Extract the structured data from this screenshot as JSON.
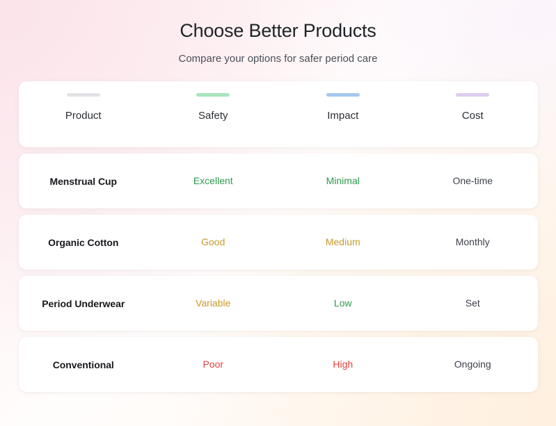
{
  "header": {
    "title": "Choose Better Products",
    "subtitle": "Compare your options for safer period care"
  },
  "colors": {
    "accent_product": "#e2e3e6",
    "accent_safety": "#a8e6bd",
    "accent_impact": "#a6c8ee",
    "accent_cost": "#ddcdf0",
    "rating_good": "#2e9a4c",
    "rating_warn": "#c79a2c",
    "rating_bad": "#e44040",
    "rating_neutral": "#3d4148",
    "card_background": "#ffffff",
    "page_background": "#fdeef2"
  },
  "table": {
    "columns": [
      {
        "key": "product",
        "label": "Product",
        "accent": "#e2e3e6"
      },
      {
        "key": "safety",
        "label": "Safety",
        "accent": "#a8e6bd"
      },
      {
        "key": "impact",
        "label": "Impact",
        "accent": "#a6c8ee"
      },
      {
        "key": "cost",
        "label": "Cost",
        "accent": "#ddcdf0"
      }
    ],
    "rows": [
      {
        "product": "Menstrual Cup",
        "safety": {
          "text": "Excellent",
          "color": "#2e9a4c"
        },
        "impact": {
          "text": "Minimal",
          "color": "#2e9a4c"
        },
        "cost": {
          "text": "One-time",
          "color": "#3d4148"
        }
      },
      {
        "product": "Organic Cotton",
        "safety": {
          "text": "Good",
          "color": "#c79a2c"
        },
        "impact": {
          "text": "Medium",
          "color": "#c79a2c"
        },
        "cost": {
          "text": "Monthly",
          "color": "#3d4148"
        }
      },
      {
        "product": "Period Underwear",
        "safety": {
          "text": "Variable",
          "color": "#c79a2c"
        },
        "impact": {
          "text": "Low",
          "color": "#2e9a4c"
        },
        "cost": {
          "text": "Set",
          "color": "#3d4148"
        }
      },
      {
        "product": "Conventional",
        "safety": {
          "text": "Poor",
          "color": "#e44040"
        },
        "impact": {
          "text": "High",
          "color": "#e44040"
        },
        "cost": {
          "text": "Ongoing",
          "color": "#3d4148"
        }
      }
    ]
  }
}
